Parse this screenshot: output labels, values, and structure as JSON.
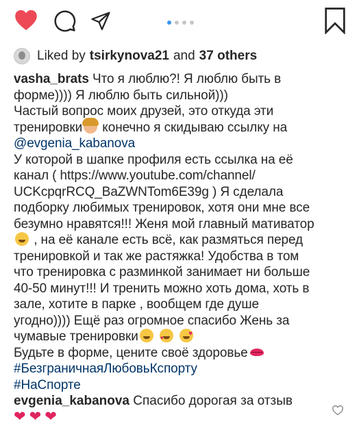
{
  "actions": {
    "like_icon": "heart-filled-icon",
    "comment_icon": "comment-bubble-icon",
    "share_icon": "paper-plane-icon",
    "save_icon": "bookmark-icon",
    "carousel_dots": 4,
    "carousel_active_index": 0,
    "colors": {
      "like": "#ed4956",
      "icon": "#262626",
      "dot_active": "#3897f0",
      "dot": "#c7c7c7",
      "mention": "#003569"
    }
  },
  "likes": {
    "prefix": "Liked by",
    "user": "tsirkynova21",
    "connector": "and",
    "others": "37 others"
  },
  "caption": {
    "username": "vasha_brats",
    "lines": [
      "Что я люблю?! Я люблю быть в",
      "форме)))) Я люблю быть сильной)))",
      "Частый вопрос моих друзей, это откуда эти",
      "тренировки",
      "конечно я скидываю ссылку на",
      "@evgenia_kabanova",
      "У которой в шапке профиля есть ссылка на её",
      "канал ( https://www.youtube.com/channel/",
      "UCKcpqrRCQ_BaZWNTom6E39g )  Я сделала",
      "подборку любимых тренировок, хотя они мне все",
      "безумно нравятся!!! Женя мой главный мативатор",
      ", на её канале есть всё, как размяться перед",
      "тренировкой и так же растяжка! Удобства в том",
      "что тренировка с разминкой занимает ни больше",
      "40-50 минут!!! И тренить можно хоть дома, хоть в",
      "зале, хотите в парке , вообщем где душе",
      "угодно)))) Ещё раз огромное спасибо Жень за",
      "чумавые тренировки",
      "Будьте в форме, цените своё здоровье",
      "#БезграничнаяЛюбовьКспорту",
      "#НаСпорте"
    ]
  },
  "reply": {
    "username": "evgenia_kabanova",
    "text": "Спасибо дорогая за отзыв",
    "hearts": [
      "❤",
      "❤",
      "❤"
    ],
    "like_icon": "heart-outline-icon"
  }
}
